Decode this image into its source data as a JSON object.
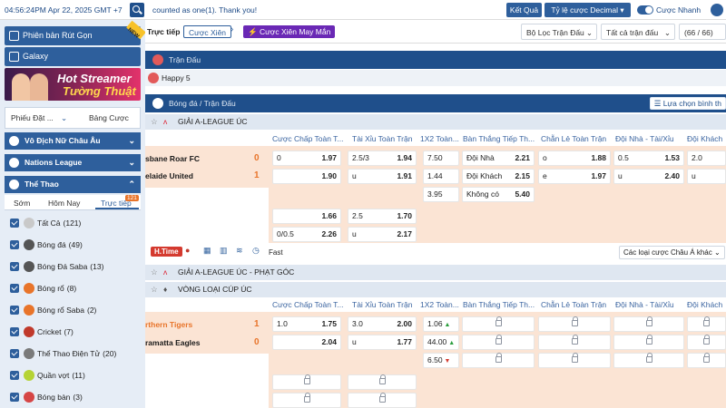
{
  "topbar": {
    "time": "04:56:24PM Apr 22, 2025 GMT +7",
    "marquee": "counted as one(1). Thank you!",
    "result_btn": "Kết Quả",
    "odds_btn": "Tỷ lệ cược Decimal",
    "quick_bet": "Cược Nhanh"
  },
  "sidebar": {
    "lite_btn": "Phiên bản Rút Gọn",
    "galaxy_btn": "Galaxy",
    "new_tag": "NEW",
    "banner_line1": "Hot Streamer",
    "banner_line2": "Tường Thuật",
    "tab1": "Phiếu Đặt ...",
    "tab2": "Bảng Cược",
    "sections": [
      "Vô Địch Nữ Châu Âu",
      "Nations League",
      "Thể Thao"
    ],
    "subtabs": [
      "Sớm",
      "Hôm Nay",
      "Trực tiếp"
    ],
    "live_count": "121",
    "sports": [
      {
        "label": "Tất Cả",
        "count": "(121)",
        "color": "#c9c9c9"
      },
      {
        "label": "Bóng đá",
        "count": "(49)",
        "color": "#555"
      },
      {
        "label": "Bóng Đá Saba",
        "count": "(13)",
        "color": "#555"
      },
      {
        "label": "Bóng rổ",
        "count": "(8)",
        "color": "#e8742a"
      },
      {
        "label": "Bóng rổ Saba",
        "count": "(2)",
        "color": "#e8742a"
      },
      {
        "label": "Cricket",
        "count": "(7)",
        "color": "#c0392b"
      },
      {
        "label": "Thể Thao Điện Tử",
        "count": "(20)",
        "color": "#7a7a7a"
      },
      {
        "label": "Quần vợt",
        "count": "(11)",
        "color": "#b5d335"
      },
      {
        "label": "Bóng bàn",
        "count": "(3)",
        "color": "#d64545"
      }
    ]
  },
  "toolbar": {
    "live": "Trực tiếp",
    "parlay": "Cược Xiên",
    "lucky_parlay": "Cược Xiên May Mắn",
    "filter": "Bộ Lọc Trận Đấu",
    "all_matches": "Tất cả trận đấu",
    "count": "(66 / 66)"
  },
  "groups": {
    "match": "Trận Đấu",
    "happy": "Happy 5",
    "football": "Bóng đá / Trận Đấu",
    "choose_bet": "Lựa chọn bình th"
  },
  "columns": [
    "Cược Chấp Toàn T...",
    "Tài Xỉu Toàn Trận",
    "1X2 Toàn...",
    "Bàn Thắng Tiếp Th...",
    "Chẵn Lẻ Toàn Trận",
    "Đội Nhà - Tài/Xỉu",
    "Đội Khách"
  ],
  "league1": {
    "name": "GIẢI A-LEAGUE ÚC",
    "team1": "sbane Roar FC",
    "score1": "0",
    "team2": "elaide United",
    "score2": "1",
    "r1": [
      "0",
      "1.97",
      "2.5/3",
      "1.94",
      "7.50",
      "Đội Nhà",
      "2.21",
      "o",
      "1.88",
      "0.5",
      "1.53",
      "2.0"
    ],
    "r2": [
      "",
      "1.90",
      "u",
      "1.91",
      "1.44",
      "Đội Khách",
      "2.15",
      "e",
      "1.97",
      "u",
      "2.40",
      "u"
    ],
    "r3": [
      "3.95",
      "Không có",
      "5.40"
    ],
    "r4": [
      "",
      "1.66",
      "2.5",
      "1.70"
    ],
    "r5": [
      "0/0.5",
      "2.26",
      "u",
      "2.17"
    ]
  },
  "tools": {
    "htime": "H.Time",
    "fast": "Fast",
    "asian": "Các loại cược Châu Á khác"
  },
  "league2": {
    "name": "GIẢI A-LEAGUE ÚC - PHẠT GÓC"
  },
  "league3": {
    "name": "VÒNG LOẠI CÚP ÚC",
    "team1": "rthern Tigers",
    "score1": "1",
    "team2": "ramatta Eagles",
    "score2": "0",
    "r1": [
      "1.0",
      "1.75",
      "3.0",
      "2.00",
      "1.06"
    ],
    "r2": [
      "",
      "2.04",
      "u",
      "1.77",
      "44.00"
    ],
    "r3": [
      "6.50"
    ]
  }
}
